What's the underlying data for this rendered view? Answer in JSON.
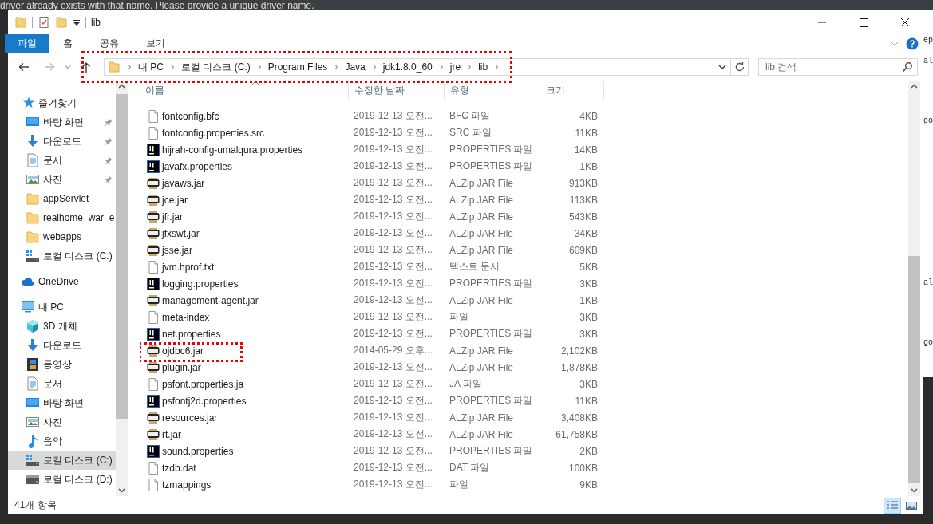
{
  "background": {
    "message": "driver already exists with that name. Please provide a unique driver name.",
    "code_fragments": [
      "ep",
      "al",
      "go",
      "al",
      "go"
    ]
  },
  "window": {
    "title": "lib"
  },
  "ribbon_tabs": [
    {
      "label": "파일",
      "selected": true
    },
    {
      "label": "홈",
      "selected": false
    },
    {
      "label": "공유",
      "selected": false
    },
    {
      "label": "보기",
      "selected": false
    }
  ],
  "address": {
    "annotated": true,
    "crumbs": [
      "내 PC",
      "로컬 디스크 (C:)",
      "Program Files",
      "Java",
      "jdk1.8.0_60",
      "jre",
      "lib"
    ]
  },
  "search": {
    "placeholder": "lib 검색"
  },
  "sidebar": [
    {
      "label": "즐겨찾기",
      "kind": "star",
      "selected": false,
      "children": [
        {
          "label": "바탕 화면",
          "kind": "desktop",
          "pinned": true,
          "selected": false
        },
        {
          "label": "다운로드",
          "kind": "download",
          "pinned": true,
          "selected": false
        },
        {
          "label": "문서",
          "kind": "document",
          "pinned": true,
          "selected": false
        },
        {
          "label": "사진",
          "kind": "photo",
          "pinned": true,
          "selected": false
        },
        {
          "label": "appServlet",
          "kind": "folder",
          "pinned": false,
          "selected": false
        },
        {
          "label": "realhome_war_e",
          "kind": "folder",
          "pinned": false,
          "selected": false
        },
        {
          "label": "webapps",
          "kind": "folder",
          "pinned": false,
          "selected": false
        },
        {
          "label": "로컬 디스크 (C:)",
          "kind": "windrive",
          "pinned": false,
          "selected": false
        }
      ]
    },
    {
      "label": "OneDrive",
      "kind": "cloud",
      "selected": false
    },
    {
      "label": "내 PC",
      "kind": "pc",
      "selected": false,
      "children": [
        {
          "label": "3D 개체",
          "kind": "cube",
          "pinned": false,
          "selected": false
        },
        {
          "label": "다운로드",
          "kind": "download",
          "pinned": false,
          "selected": false
        },
        {
          "label": "동영상",
          "kind": "video",
          "pinned": false,
          "selected": false
        },
        {
          "label": "문서",
          "kind": "document",
          "pinned": false,
          "selected": false
        },
        {
          "label": "바탕 화면",
          "kind": "desktop",
          "pinned": false,
          "selected": false
        },
        {
          "label": "사진",
          "kind": "photo",
          "pinned": false,
          "selected": false
        },
        {
          "label": "음악",
          "kind": "music",
          "pinned": false,
          "selected": false
        },
        {
          "label": "로컬 디스크 (C:)",
          "kind": "windrive",
          "pinned": false,
          "selected": true
        },
        {
          "label": "로컬 디스크 (D:)",
          "kind": "drive",
          "pinned": false,
          "selected": false
        }
      ]
    }
  ],
  "columns": [
    "이름",
    "수정한 날짜",
    "유형",
    "크기"
  ],
  "rows": [
    {
      "name": "fontconfig.bfc",
      "date": "2019-12-13 오전...",
      "type": "BFC 파일",
      "size": "4KB",
      "kind": "file",
      "annotated": false
    },
    {
      "name": "fontconfig.properties.src",
      "date": "2019-12-13 오전...",
      "type": "SRC 파일",
      "size": "11KB",
      "kind": "file",
      "annotated": false
    },
    {
      "name": "hijrah-config-umalqura.properties",
      "date": "2019-12-13 오전...",
      "type": "PROPERTIES 파일",
      "size": "14KB",
      "kind": "ij",
      "annotated": false
    },
    {
      "name": "javafx.properties",
      "date": "2019-12-13 오전...",
      "type": "PROPERTIES 파일",
      "size": "1KB",
      "kind": "ij",
      "annotated": false
    },
    {
      "name": "javaws.jar",
      "date": "2019-12-13 오전...",
      "type": "ALZip JAR File",
      "size": "913KB",
      "kind": "jar",
      "annotated": false
    },
    {
      "name": "jce.jar",
      "date": "2019-12-13 오전...",
      "type": "ALZip JAR File",
      "size": "113KB",
      "kind": "jar",
      "annotated": false
    },
    {
      "name": "jfr.jar",
      "date": "2019-12-13 오전...",
      "type": "ALZip JAR File",
      "size": "543KB",
      "kind": "jar",
      "annotated": false
    },
    {
      "name": "jfxswt.jar",
      "date": "2019-12-13 오전...",
      "type": "ALZip JAR File",
      "size": "34KB",
      "kind": "jar",
      "annotated": false
    },
    {
      "name": "jsse.jar",
      "date": "2019-12-13 오전...",
      "type": "ALZip JAR File",
      "size": "609KB",
      "kind": "jar",
      "annotated": false
    },
    {
      "name": "jvm.hprof.txt",
      "date": "2019-12-13 오전...",
      "type": "텍스트 문서",
      "size": "5KB",
      "kind": "file",
      "annotated": false
    },
    {
      "name": "logging.properties",
      "date": "2019-12-13 오전...",
      "type": "PROPERTIES 파일",
      "size": "3KB",
      "kind": "ij",
      "annotated": false
    },
    {
      "name": "management-agent.jar",
      "date": "2019-12-13 오전...",
      "type": "ALZip JAR File",
      "size": "1KB",
      "kind": "jar",
      "annotated": false
    },
    {
      "name": "meta-index",
      "date": "2019-12-13 오전...",
      "type": "파일",
      "size": "3KB",
      "kind": "file",
      "annotated": false
    },
    {
      "name": "net.properties",
      "date": "2019-12-13 오전...",
      "type": "PROPERTIES 파일",
      "size": "3KB",
      "kind": "ij",
      "annotated": false
    },
    {
      "name": "ojdbc6.jar",
      "date": "2014-05-29 오후...",
      "type": "ALZip JAR File",
      "size": "2,102KB",
      "kind": "jar",
      "annotated": true
    },
    {
      "name": "plugin.jar",
      "date": "2019-12-13 오전...",
      "type": "ALZip JAR File",
      "size": "1,878KB",
      "kind": "jar",
      "annotated": false
    },
    {
      "name": "psfont.properties.ja",
      "date": "2019-12-13 오전...",
      "type": "JA 파일",
      "size": "3KB",
      "kind": "file",
      "annotated": false
    },
    {
      "name": "psfontj2d.properties",
      "date": "2019-12-13 오전...",
      "type": "PROPERTIES 파일",
      "size": "11KB",
      "kind": "ij",
      "annotated": false
    },
    {
      "name": "resources.jar",
      "date": "2019-12-13 오전...",
      "type": "ALZip JAR File",
      "size": "3,408KB",
      "kind": "jar",
      "annotated": false
    },
    {
      "name": "rt.jar",
      "date": "2019-12-13 오전...",
      "type": "ALZip JAR File",
      "size": "61,758KB",
      "kind": "jar",
      "annotated": false
    },
    {
      "name": "sound.properties",
      "date": "2019-12-13 오전...",
      "type": "PROPERTIES 파일",
      "size": "2KB",
      "kind": "ij",
      "annotated": false
    },
    {
      "name": "tzdb.dat",
      "date": "2019-12-13 오전...",
      "type": "DAT 파일",
      "size": "100KB",
      "kind": "file",
      "annotated": false
    },
    {
      "name": "tzmappings",
      "date": "2019-12-13 오전...",
      "type": "파일",
      "size": "9KB",
      "kind": "file",
      "annotated": false
    }
  ],
  "status_bar": {
    "count": "41개 항목"
  },
  "view_buttons": [
    {
      "kind": "details",
      "selected": true
    },
    {
      "kind": "large-icons",
      "selected": false
    }
  ]
}
